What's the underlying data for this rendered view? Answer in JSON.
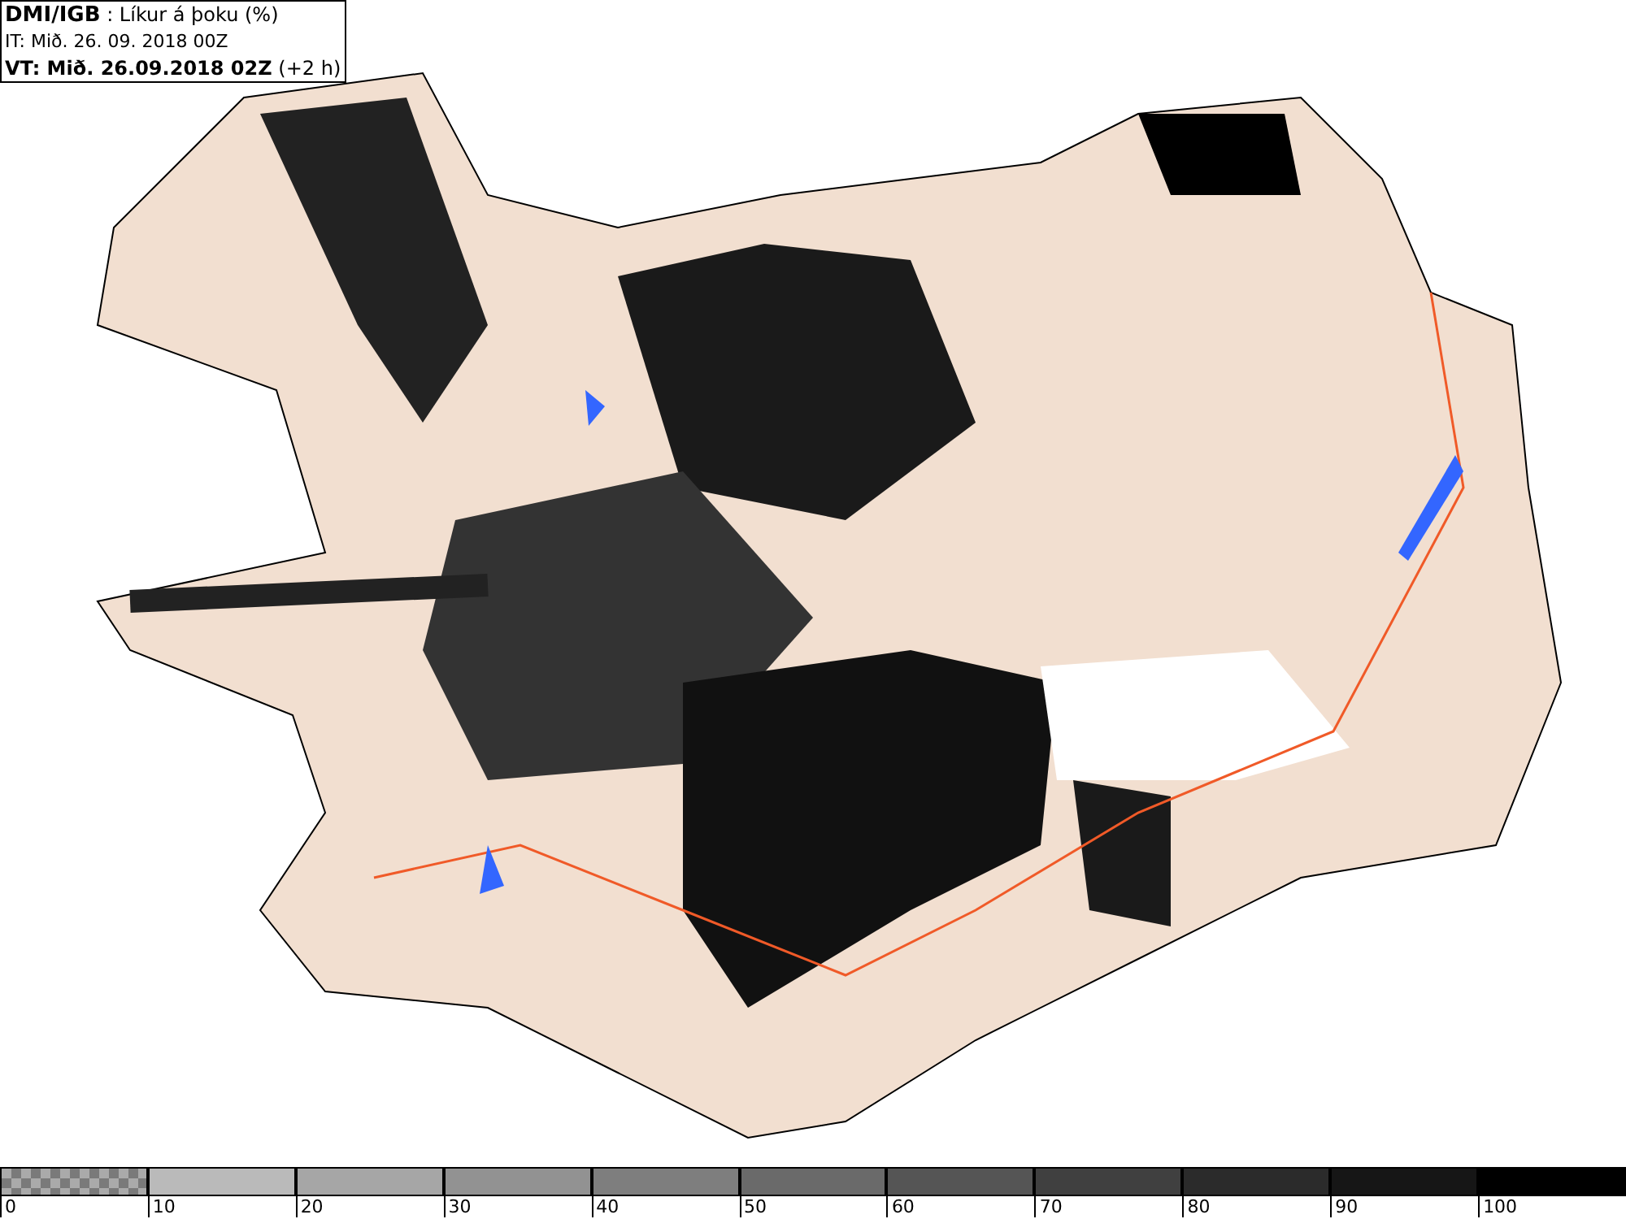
{
  "header": {
    "source": "DMI/IGB",
    "title": ": Líkur á þoku (%)",
    "issue_time": "IT: Mið. 26. 09. 2018 00Z",
    "valid_time": "VT: Mið. 26.09.2018 02Z",
    "lead": "(+2 h)"
  },
  "legend": [
    {
      "label": "0",
      "kind": "checker",
      "color": "#7a7a7a"
    },
    {
      "label": "10",
      "kind": "solid",
      "color": "#bababa"
    },
    {
      "label": "20",
      "kind": "solid",
      "color": "#a6a6a6"
    },
    {
      "label": "30",
      "kind": "solid",
      "color": "#929292"
    },
    {
      "label": "40",
      "kind": "solid",
      "color": "#7e7e7e"
    },
    {
      "label": "50",
      "kind": "solid",
      "color": "#6a6a6a"
    },
    {
      "label": "60",
      "kind": "solid",
      "color": "#555555"
    },
    {
      "label": "70",
      "kind": "solid",
      "color": "#404040"
    },
    {
      "label": "80",
      "kind": "solid",
      "color": "#2b2b2b"
    },
    {
      "label": "90",
      "kind": "solid",
      "color": "#161616"
    },
    {
      "label": "100",
      "kind": "solid",
      "color": "#000000"
    }
  ]
}
